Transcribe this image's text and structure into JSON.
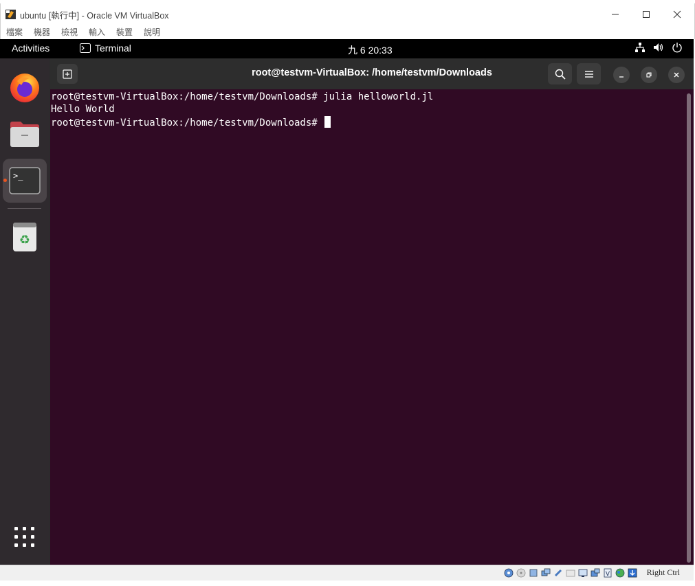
{
  "vbox": {
    "title": "ubuntu [執行中] - Oracle VM VirtualBox",
    "menu": [
      "檔案",
      "機器",
      "檢視",
      "輸入",
      "裝置",
      "說明"
    ],
    "host_key": "Right Ctrl"
  },
  "topbar": {
    "activities": "Activities",
    "app_name": "Terminal",
    "clock": "九 6  20:33"
  },
  "dock": {
    "items": [
      "firefox-icon",
      "files-icon",
      "terminal-icon",
      "trash-icon",
      "app-grid-icon"
    ],
    "active": "terminal"
  },
  "terminal": {
    "title": "root@testvm-VirtualBox: /home/testvm/Downloads",
    "lines": [
      "root@testvm-VirtualBox:/home/testvm/Downloads# julia helloworld.jl",
      "Hello World",
      "root@testvm-VirtualBox:/home/testvm/Downloads# "
    ]
  },
  "colors": {
    "terminal_bg": "#300a24",
    "dock_bg": "#2f2a2e",
    "topbar_bg": "#000000",
    "header_bg": "#2d2d2d",
    "active_indicator": "#e95420"
  }
}
